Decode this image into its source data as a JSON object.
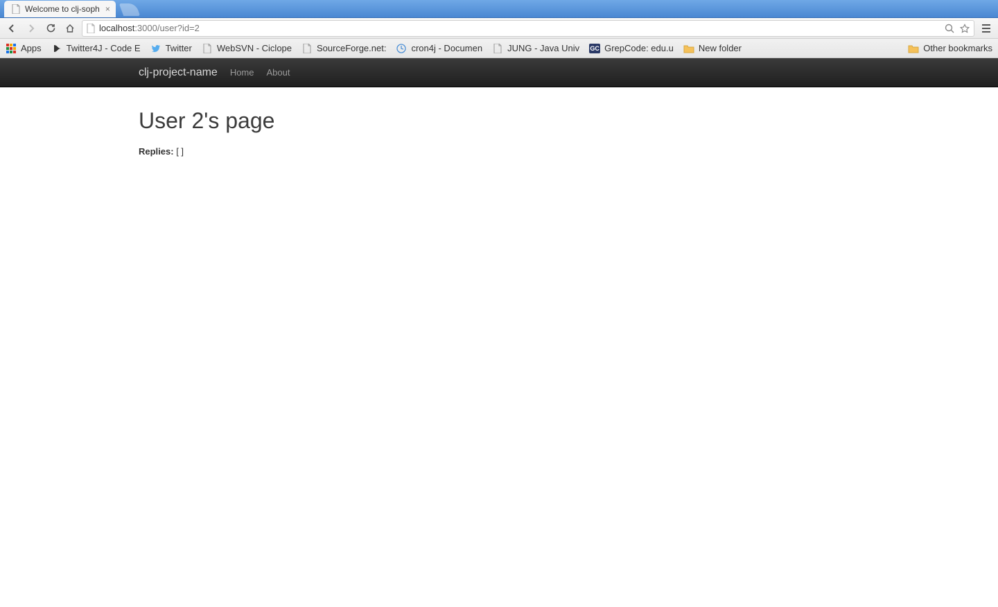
{
  "tab": {
    "title": "Welcome to clj-soph"
  },
  "toolbar": {
    "url_host": "localhost",
    "url_path": ":3000/user?id=2"
  },
  "bookmarks": {
    "apps_label": "Apps",
    "items": [
      "Twitter4J - Code E",
      "Twitter",
      "WebSVN - Ciclope",
      "SourceForge.net:",
      "cron4j - Documen",
      "JUNG - Java Univ",
      "GrepCode: edu.u",
      "New folder"
    ],
    "other_label": "Other bookmarks"
  },
  "navbar": {
    "brand": "clj-project-name",
    "links": [
      "Home",
      "About"
    ]
  },
  "content": {
    "title": "User 2's page",
    "replies_label": "Replies:",
    "replies_value": "[ ]"
  }
}
